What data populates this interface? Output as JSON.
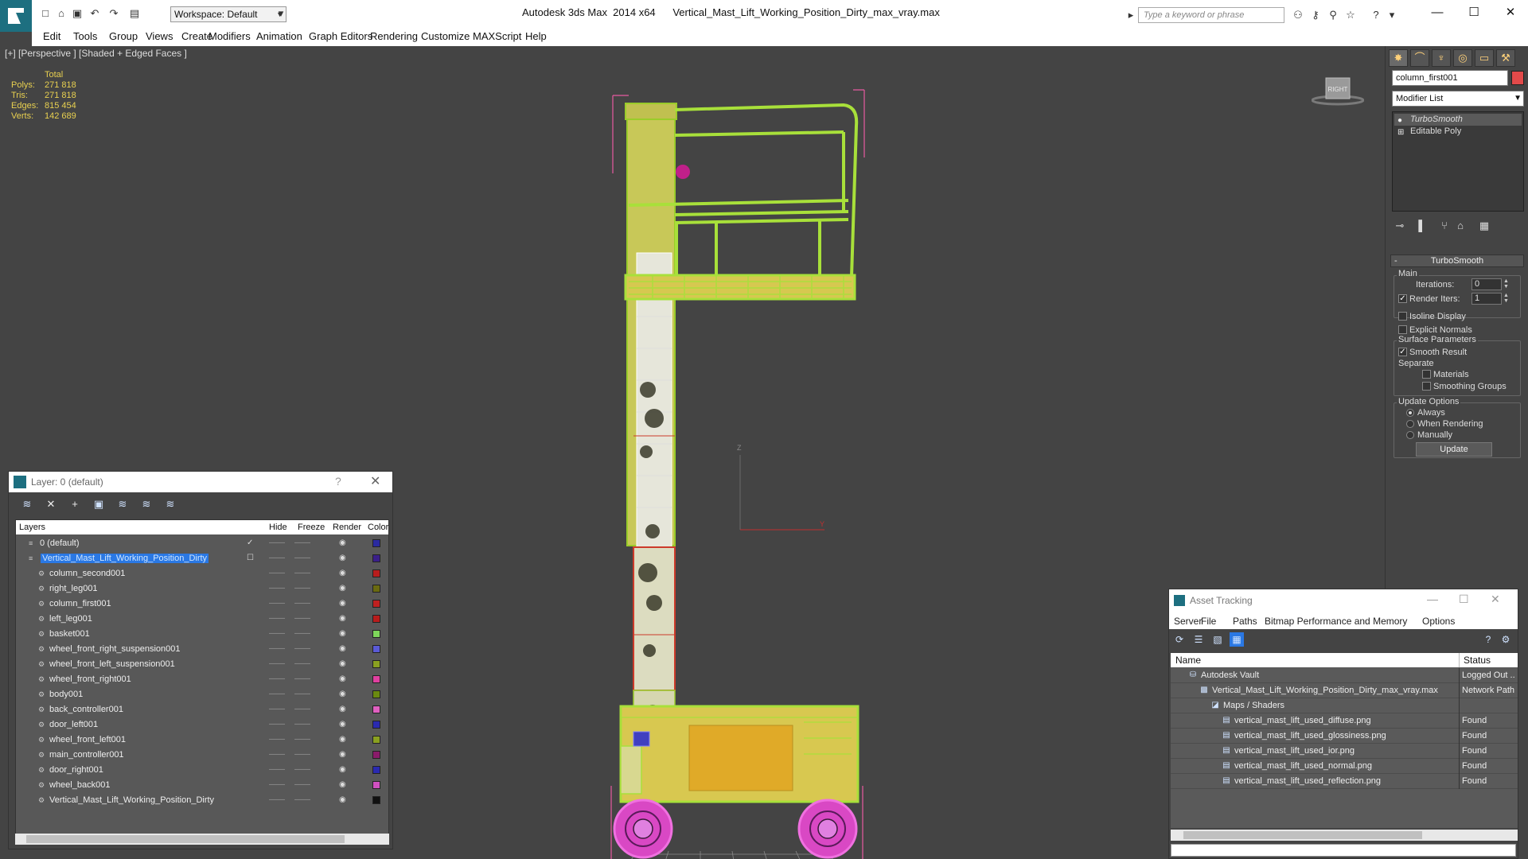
{
  "app": {
    "title": "Autodesk 3ds Max  2014 x64      Vertical_Mast_Lift_Working_Position_Dirty_max_vray.max",
    "workspace_label": "Workspace: Default",
    "search_placeholder": "Type a keyword or phrase"
  },
  "menu": [
    "Edit",
    "Tools",
    "Group",
    "Views",
    "Create",
    "Modifiers",
    "Animation",
    "Graph Editors",
    "Rendering",
    "Customize",
    "MAXScript",
    "Help"
  ],
  "viewport": {
    "label": "[+] [Perspective ] [Shaded + Edged Faces ]",
    "stats": {
      "total_label": "Total",
      "rows": [
        {
          "label": "Polys:",
          "value": "271 818"
        },
        {
          "label": "Tris:",
          "value": "271 818"
        },
        {
          "label": "Edges:",
          "value": "815 454"
        },
        {
          "label": "Verts:",
          "value": "142 689"
        }
      ]
    },
    "viewcube_label": "RIGHT",
    "axis_x": "Y",
    "axis_z": "Z"
  },
  "command_panel": {
    "object_name": "column_first001",
    "object_color": "#e24a4a",
    "modifier_list_label": "Modifier List",
    "stack": [
      "TurboSmooth",
      "Editable Poly"
    ],
    "rollout_title": "TurboSmooth",
    "main_label": "Main",
    "iterations_label": "Iterations:",
    "iterations_value": "0",
    "render_iters_label": "Render Iters:",
    "render_iters_value": "1",
    "render_iters_checked": true,
    "isoline_label": "Isoline Display",
    "explicit_normals_label": "Explicit Normals",
    "surface_params_label": "Surface Parameters",
    "smooth_result_label": "Smooth Result",
    "smooth_result_checked": true,
    "separate_label": "Separate",
    "materials_label": "Materials",
    "smoothing_groups_label": "Smoothing Groups",
    "update_options_label": "Update Options",
    "always_label": "Always",
    "when_rendering_label": "When Rendering",
    "manually_label": "Manually",
    "update_button": "Update"
  },
  "layer_dialog": {
    "title": "Layer: 0 (default)",
    "help": "?",
    "columns": {
      "layers": "Layers",
      "hide": "Hide",
      "freeze": "Freeze",
      "render": "Render",
      "color": "Color"
    },
    "rows": [
      {
        "name": "0 (default)",
        "level": 0,
        "color": "#2a2aa0",
        "active": true
      },
      {
        "name": "Vertical_Mast_Lift_Working_Position_Dirty",
        "level": 0,
        "color": "#3a1f8a",
        "selected": true
      },
      {
        "name": "column_second001",
        "level": 1,
        "color": "#b81c1c"
      },
      {
        "name": "right_leg001",
        "level": 1,
        "color": "#6a6a10"
      },
      {
        "name": "column_first001",
        "level": 1,
        "color": "#c02020"
      },
      {
        "name": "left_leg001",
        "level": 1,
        "color": "#b81c1c"
      },
      {
        "name": "basket001",
        "level": 1,
        "color": "#7ed65a"
      },
      {
        "name": "wheel_front_right_suspension001",
        "level": 1,
        "color": "#5a5ad6"
      },
      {
        "name": "wheel_front_left_suspension001",
        "level": 1,
        "color": "#8aa020"
      },
      {
        "name": "wheel_front_right001",
        "level": 1,
        "color": "#e040a0"
      },
      {
        "name": "body001",
        "level": 1,
        "color": "#6a8a10"
      },
      {
        "name": "back_controller001",
        "level": 1,
        "color": "#e060c0"
      },
      {
        "name": "door_left001",
        "level": 1,
        "color": "#2a2ab0"
      },
      {
        "name": "wheel_front_left001",
        "level": 1,
        "color": "#8aa020"
      },
      {
        "name": "main_controller001",
        "level": 1,
        "color": "#8a1a6a"
      },
      {
        "name": "door_right001",
        "level": 1,
        "color": "#2a2ab0"
      },
      {
        "name": "wheel_back001",
        "level": 1,
        "color": "#d050c0"
      },
      {
        "name": "Vertical_Mast_Lift_Working_Position_Dirty",
        "level": 1,
        "color": "#111111"
      }
    ]
  },
  "asset_dialog": {
    "title": "Asset Tracking",
    "menu": [
      "Server",
      "File",
      "Paths",
      "Bitmap Performance and Memory",
      "Options"
    ],
    "columns": {
      "name": "Name",
      "status": "Status"
    },
    "rows": [
      {
        "name": "Autodesk Vault",
        "level": 0,
        "status": "Logged Out ..",
        "icon": "vault-icon"
      },
      {
        "name": "Vertical_Mast_Lift_Working_Position_Dirty_max_vray.max",
        "level": 1,
        "status": "Network Path",
        "icon": "max-file-icon"
      },
      {
        "name": "Maps / Shaders",
        "level": 2,
        "status": "",
        "icon": "maps-icon"
      },
      {
        "name": "vertical_mast_lift_used_diffuse.png",
        "level": 3,
        "status": "Found",
        "icon": "image-file-icon"
      },
      {
        "name": "vertical_mast_lift_used_glossiness.png",
        "level": 3,
        "status": "Found",
        "icon": "image-file-icon"
      },
      {
        "name": "vertical_mast_lift_used_ior.png",
        "level": 3,
        "status": "Found",
        "icon": "image-file-icon"
      },
      {
        "name": "vertical_mast_lift_used_normal.png",
        "level": 3,
        "status": "Found",
        "icon": "image-file-icon"
      },
      {
        "name": "vertical_mast_lift_used_reflection.png",
        "level": 3,
        "status": "Found",
        "icon": "image-file-icon"
      }
    ]
  }
}
